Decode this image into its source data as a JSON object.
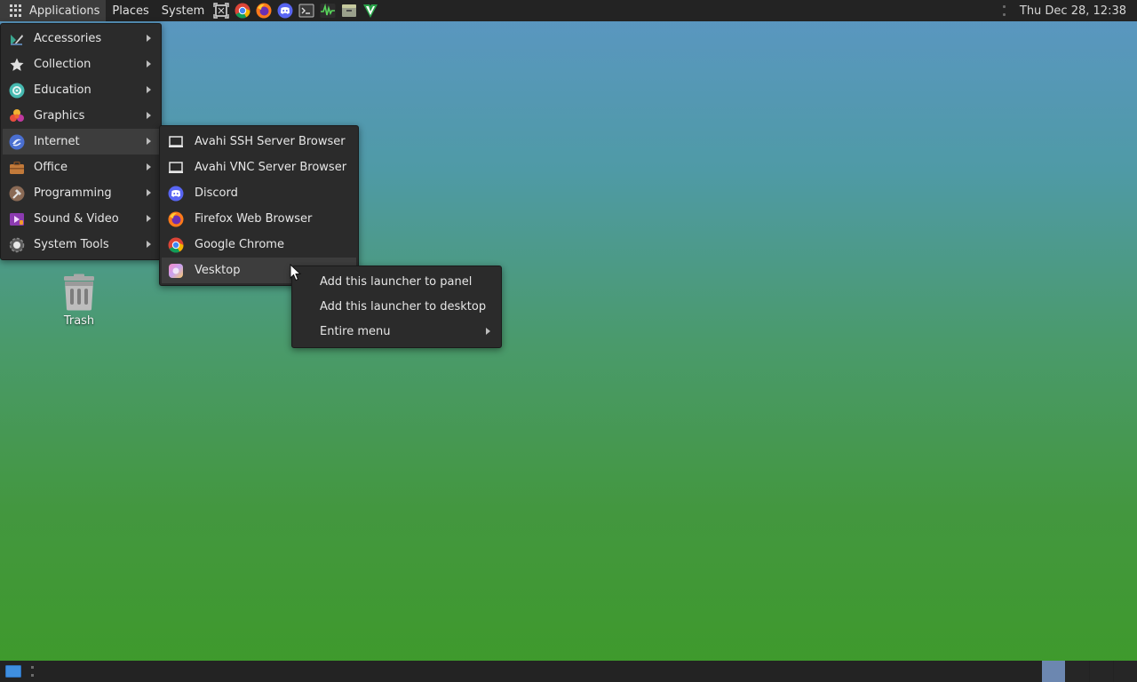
{
  "top_panel": {
    "menus": {
      "applications": "Applications",
      "places": "Places",
      "system": "System"
    },
    "launchers": [
      "screenshot-icon",
      "chrome-icon",
      "firefox-icon",
      "discord-icon",
      "terminal-icon",
      "system-monitor-icon",
      "file-manager-icon",
      "vim-icon"
    ],
    "clock": "Thu Dec 28, 12:38"
  },
  "apps_menu": {
    "items": [
      {
        "label": "Accessories",
        "icon": "accessories-icon"
      },
      {
        "label": "Collection",
        "icon": "star-icon"
      },
      {
        "label": "Education",
        "icon": "education-icon"
      },
      {
        "label": "Graphics",
        "icon": "graphics-icon"
      },
      {
        "label": "Internet",
        "icon": "internet-icon"
      },
      {
        "label": "Office",
        "icon": "office-icon"
      },
      {
        "label": "Programming",
        "icon": "programming-icon"
      },
      {
        "label": "Sound & Video",
        "icon": "sound-video-icon"
      },
      {
        "label": "System Tools",
        "icon": "system-tools-icon"
      }
    ],
    "active": "Internet"
  },
  "internet_submenu": {
    "items": [
      {
        "label": "Avahi SSH Server Browser",
        "icon": "network-icon"
      },
      {
        "label": "Avahi VNC Server Browser",
        "icon": "network-icon"
      },
      {
        "label": "Discord",
        "icon": "discord-icon"
      },
      {
        "label": "Firefox Web Browser",
        "icon": "firefox-icon"
      },
      {
        "label": "Google Chrome",
        "icon": "chrome-icon"
      },
      {
        "label": "Vesktop",
        "icon": "vesktop-icon"
      }
    ],
    "active": "Vesktop"
  },
  "context_menu": {
    "items": [
      {
        "label": "Add this launcher to panel"
      },
      {
        "label": "Add this launcher to desktop"
      },
      {
        "label": "Entire menu"
      }
    ]
  },
  "desktop": {
    "trash_label": "Trash"
  },
  "colors": {
    "panel_bg": "#232323",
    "menu_bg": "#2b2b2b",
    "menu_hover": "#3d3d3d",
    "workspace_active": "#6c87b0"
  }
}
